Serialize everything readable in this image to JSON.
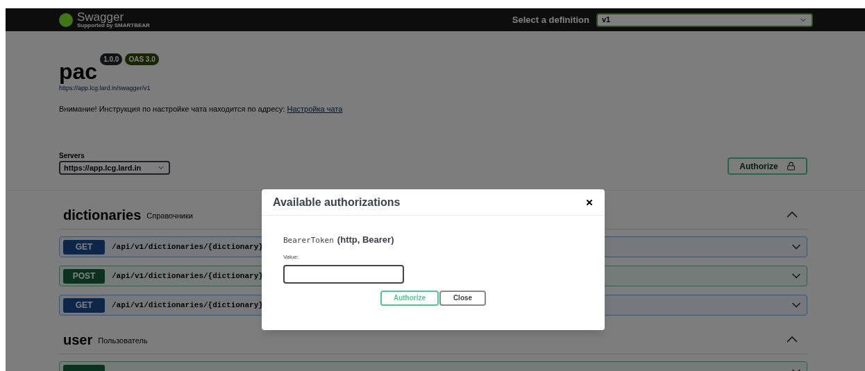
{
  "topbar": {
    "logo_text": "Swagger",
    "logo_subtext": "Supported by SMARTBEAR",
    "definition_label": "Select a definition",
    "definition_value": "v1"
  },
  "info": {
    "title": "pac",
    "version": "1.0.0",
    "oas": "OAS 3.0",
    "url": "https://app.lcg.lard.in/swagger/v1",
    "description": "Внимание! Инструкция по настройке чата находится по адресу: ",
    "link": "Настройка чата"
  },
  "servers": {
    "label": "Servers",
    "value": "https://app.lcg.lard.in"
  },
  "authorize_button": "Authorize",
  "tags": [
    {
      "name": "dictionaries",
      "description": "Справочники",
      "expanded": true,
      "operations": [
        {
          "kind": "get",
          "method": "GET",
          "path": "/api/v1/dictionaries/{dictionary}"
        },
        {
          "kind": "post",
          "method": "POST",
          "path": "/api/v1/dictionaries/{dictionary}"
        },
        {
          "kind": "get",
          "method": "GET",
          "path": "/api/v1/dictionaries/{dictionary}"
        }
      ]
    },
    {
      "name": "user",
      "description": "Пользователь",
      "expanded": true,
      "operations": [
        {
          "kind": "post"
        }
      ]
    }
  ],
  "modal": {
    "title": "Available authorizations",
    "scheme_name": "BearerToken",
    "scheme_info": "(http, Bearer)",
    "value_label": "Value:",
    "buttons": [
      {
        "kind": "authorize",
        "label": "Authorize"
      },
      {
        "kind": "close",
        "label": "Close"
      }
    ]
  }
}
